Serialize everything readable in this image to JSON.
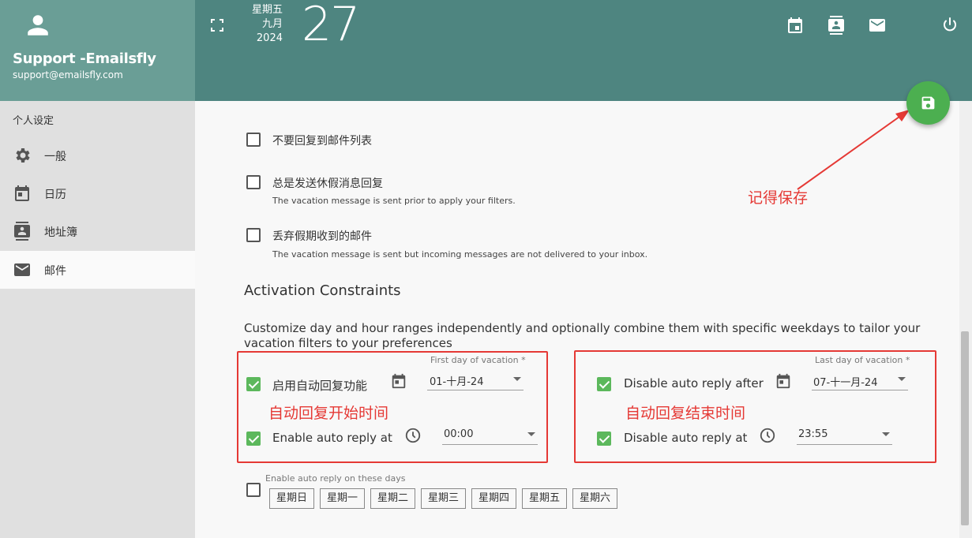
{
  "header": {
    "user_name": "Support -Emailsfly",
    "user_email": "support@emailsfly.com",
    "date_weekday": "星期五",
    "date_month": "九月",
    "date_year": "2024",
    "date_day": "27"
  },
  "sidebar": {
    "title": "个人设定",
    "items": [
      {
        "label": "一般",
        "icon": "gear-icon"
      },
      {
        "label": "日历",
        "icon": "calendar-icon"
      },
      {
        "label": "地址簿",
        "icon": "contacts-icon"
      },
      {
        "label": "邮件",
        "icon": "mail-icon",
        "active": true
      }
    ]
  },
  "options": [
    {
      "label": "不要回复到邮件列表",
      "checked": false
    },
    {
      "label": "总是发送休假消息回复",
      "sub": "The vacation message is sent prior to apply your filters.",
      "checked": false
    },
    {
      "label": "丢弃假期收到的邮件",
      "sub": "The vacation message is sent but incoming messages are not delivered to your inbox.",
      "checked": false
    }
  ],
  "activation": {
    "title": "Activation Constraints",
    "description": "Customize day and hour ranges independently and optionally combine them with specific weekdays to tailor your vacation filters to your preferences",
    "start": {
      "enable_label": "启用自动回复功能",
      "date_label": "First day of vacation",
      "date_value": "01-十月-24",
      "time_enable_label": "Enable auto reply at",
      "time_value": "00:00",
      "annotation": "自动回复开始时间"
    },
    "end": {
      "enable_label": "Disable auto reply after",
      "date_label": "Last day of vacation",
      "date_value": "07-十一月-24",
      "time_enable_label": "Disable auto reply at",
      "time_value": "23:55",
      "annotation": "自动回复结束时间"
    },
    "days_label": "Enable auto reply on these days",
    "days": [
      "星期日",
      "星期一",
      "星期二",
      "星期三",
      "星期四",
      "星期五",
      "星期六"
    ]
  },
  "annotation_save": "记得保存",
  "colors": {
    "header": "#4e8580",
    "header_left": "#6a9e96",
    "accent": "#4caf50",
    "annotation": "#e53935"
  }
}
